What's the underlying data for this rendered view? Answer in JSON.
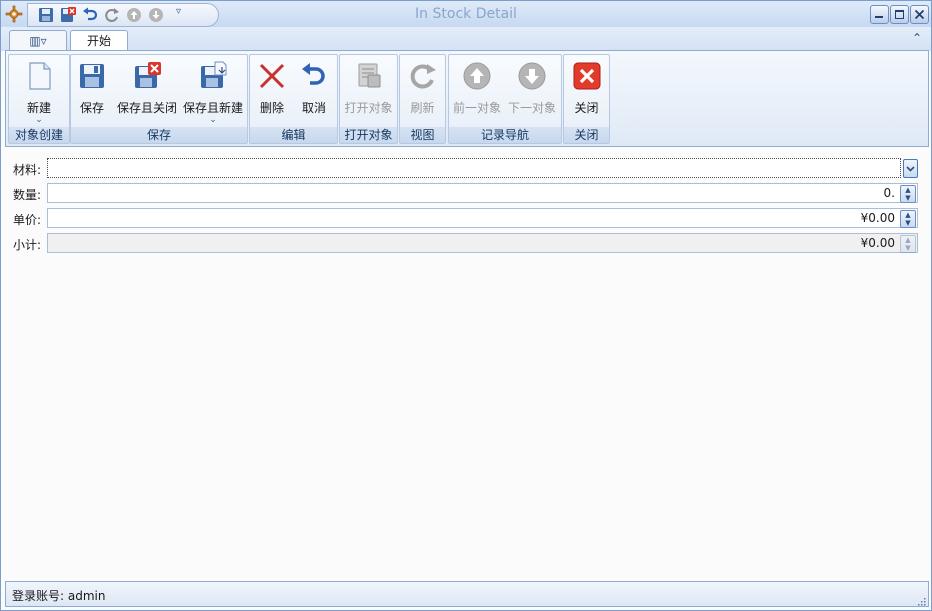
{
  "window": {
    "title": "In Stock Detail"
  },
  "tabs": {
    "view_menu": "▥▿",
    "start": "开始",
    "collapse": "⌃"
  },
  "ribbon": {
    "groups": {
      "create": "对象创建",
      "save": "保存",
      "edit": "编辑",
      "open": "打开对象",
      "view": "视图",
      "nav": "记录导航",
      "close": "关闭"
    },
    "buttons": {
      "new": "新建",
      "save": "保存",
      "save_close": "保存且关闭",
      "save_new": "保存且新建",
      "delete": "删除",
      "cancel": "取消",
      "open_object": "打开对象",
      "refresh": "刷新",
      "prev": "前一对象",
      "next": "下一对象",
      "close": "关闭"
    }
  },
  "form": {
    "material": {
      "label": "材料:",
      "value": ""
    },
    "quantity": {
      "label": "数量:",
      "value": "0."
    },
    "unit_price": {
      "label": "单价:",
      "value": "¥0.00"
    },
    "subtotal": {
      "label": "小计:",
      "value": "¥0.00"
    }
  },
  "status": {
    "account": "登录账号: admin"
  },
  "colors": {
    "accent": "#4a78b8",
    "close_red": "#e23a2b"
  }
}
